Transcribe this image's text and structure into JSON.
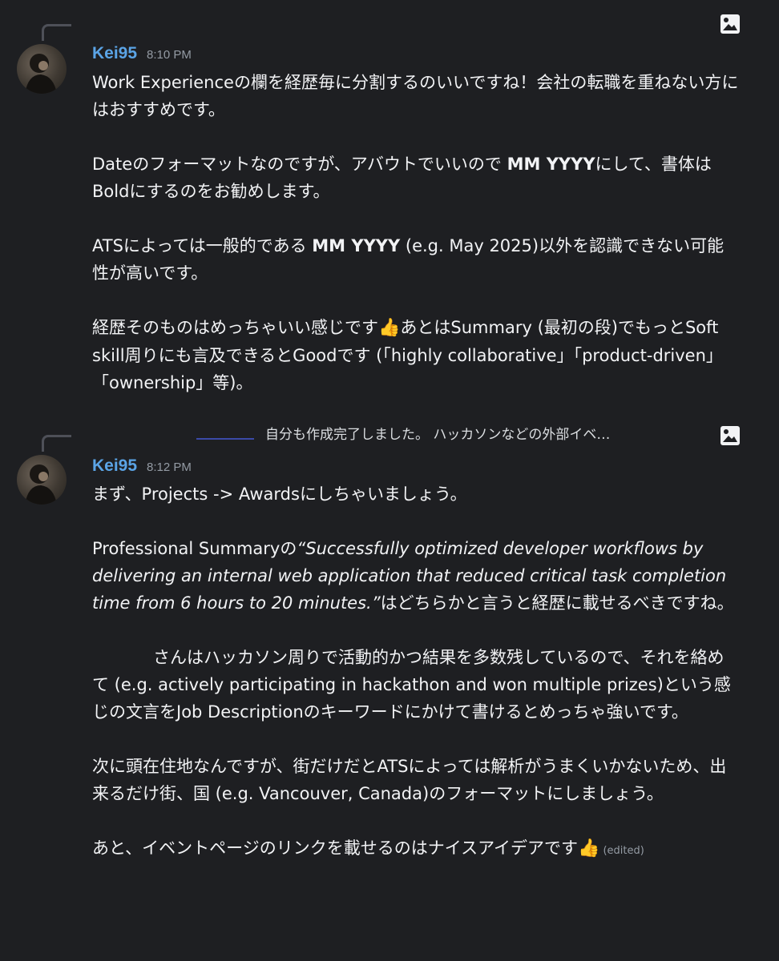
{
  "messages": [
    {
      "author": "Kei95",
      "time": "8:10 PM",
      "p1": "Work Experienceの欄を経歴毎に分割するのいいですね！会社の転職を重ねない方にはおすすめです。",
      "p2_a": "Dateのフォーマットなのですが、アバウトでいいので ",
      "p2_bold": "MM YYYY",
      "p2_b": "にして、書体はBoldにするのをお勧めします。",
      "p3_a": "ATSによっては一般的である ",
      "p3_bold": "MM YYYY",
      "p3_b": " (e.g. May 2025)以外を認識できない可能性が高いです。",
      "p4_a": "経歴そのものはめっちゃいい感じです",
      "p4_b": "あとはSummary (最初の段)でもっとSoft skill周りにも言及できるとGoodです (「highly collaborative」「product-driven」「ownership」等)。",
      "emoji_name": "thumbs-up"
    },
    {
      "reply_preview": "自分も作成完了しました。 ハッカソンなどの外部イベ…",
      "author": "Kei95",
      "time": "8:12 PM",
      "p1": "まず、Projects -> Awardsにしちゃいましょう。",
      "p2_a": "Professional Summaryの",
      "p2_italic": "“Successfully optimized developer workflows by delivering an internal web application that reduced critical task completion time from 6 hours to 20 minutes.”",
      "p2_b": "はどちらかと言うと経歴に載せるべきですね。",
      "p3": "さんはハッカソン周りで活動的かつ結果を多数残しているので、それを絡めて (e.g. actively participating in hackathon and won multiple prizes)という感じの文言をJob Descriptionのキーワードにかけて書けるとめっちゃ強いです。",
      "p4": "次に頭在住地なんですが、街だけだとATSによっては解析がうまくいかないため、出来るだけ街、国 (e.g. Vancouver, Canada)のフォーマットにしましょう。",
      "p5": "あと、イベントページのリンクを載せるのはナイスアイデアです",
      "edited": "(edited)",
      "emoji_name": "thumbs-up"
    }
  ],
  "icons": {
    "reply_image": "image-icon"
  },
  "colors": {
    "background": "#1e1f22",
    "author": "#5ba4e6",
    "timestamp": "#949ba4",
    "text": "#f2f3f5"
  }
}
